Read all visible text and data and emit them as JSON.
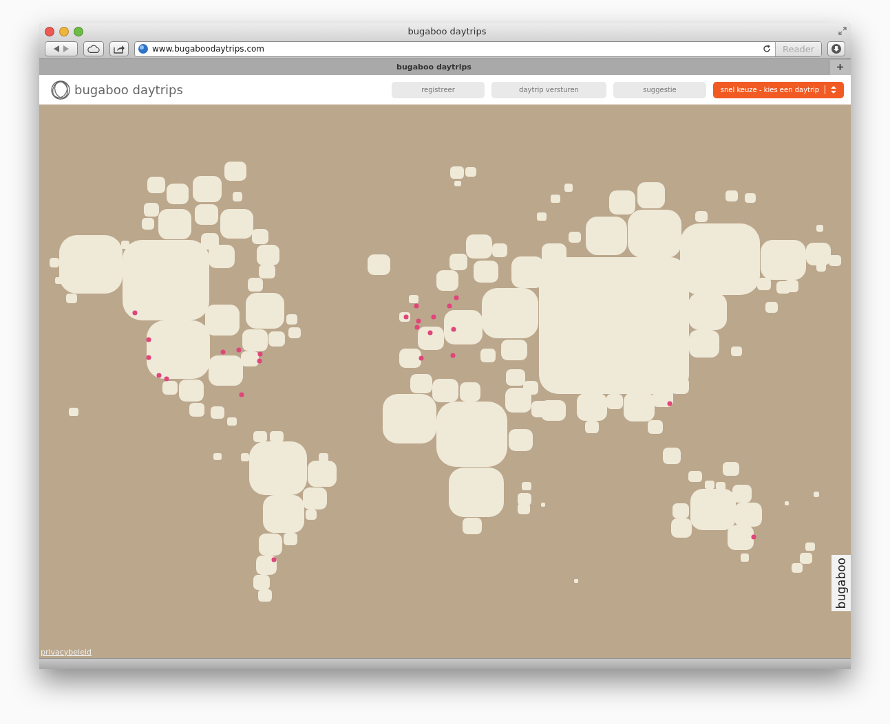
{
  "window": {
    "title": "bugaboo daytrips"
  },
  "toolbar": {
    "url": "www.bugaboodaytrips.com",
    "reader_button": "Reader"
  },
  "tab": {
    "title": "bugaboo daytrips"
  },
  "header": {
    "logo_text": "bugaboo daytrips",
    "nav": [
      {
        "label": "registreer",
        "kind": "plain"
      },
      {
        "label": "daytrip versturen",
        "kind": "plain"
      },
      {
        "label": "suggestie",
        "kind": "plain"
      },
      {
        "label": "snel keuze - kies een daytrip",
        "kind": "dropdown"
      }
    ]
  },
  "side_tab": {
    "label": "bugaboo"
  },
  "footer": {
    "link": "privacybeleid"
  }
}
